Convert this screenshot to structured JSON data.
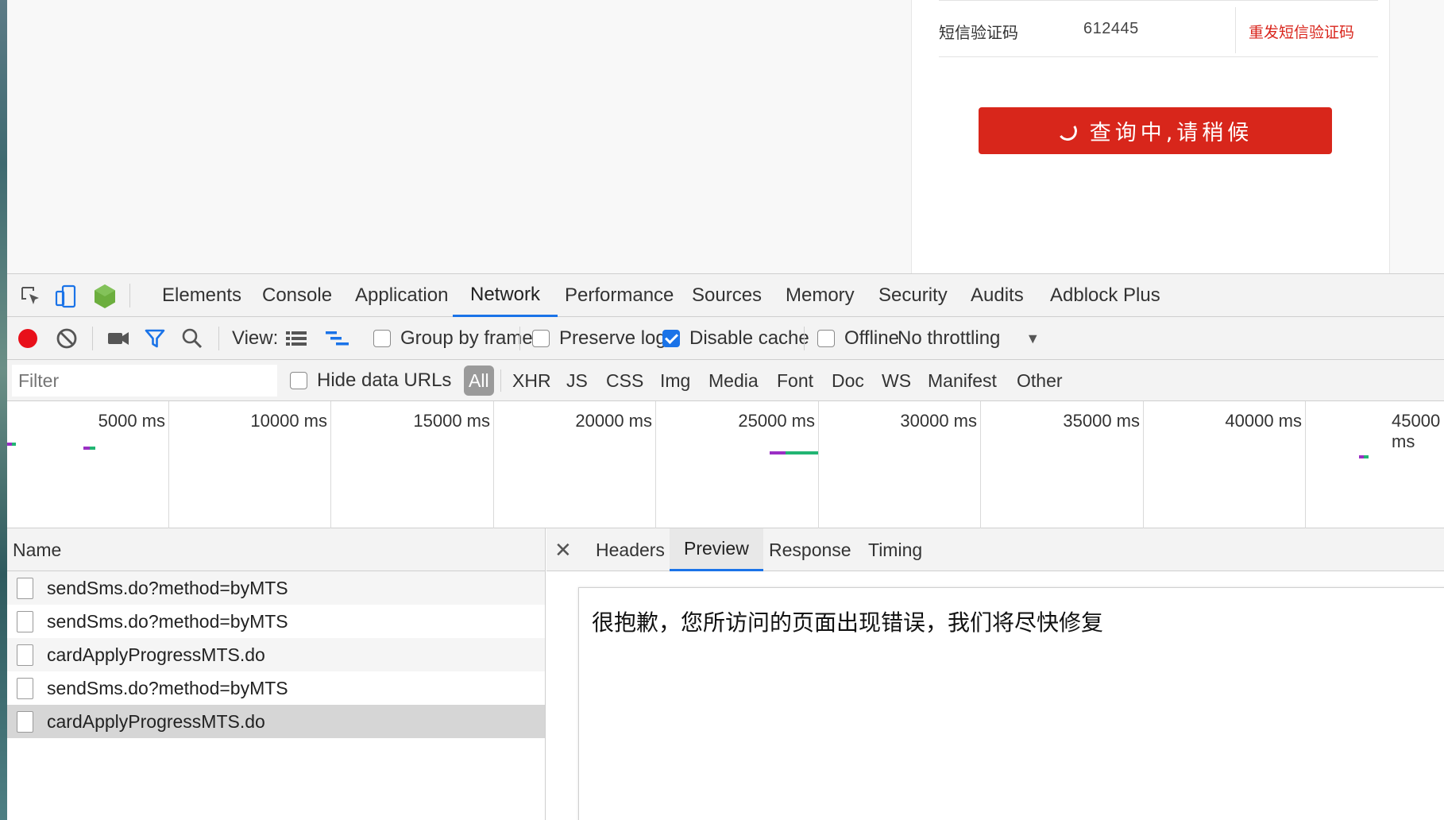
{
  "page": {
    "sms_label": "短信验证码",
    "sms_value": "612445",
    "resend_link": "重发短信验证码",
    "query_button": "查询中,请稍候"
  },
  "devtools": {
    "tabs": [
      "Elements",
      "Console",
      "Application",
      "Network",
      "Performance",
      "Sources",
      "Memory",
      "Security",
      "Audits",
      "Adblock Plus"
    ],
    "active_tab": "Network",
    "toolbar": {
      "view_label": "View:",
      "group_by_frame": "Group by frame",
      "preserve_log": "Preserve log",
      "disable_cache": "Disable cache",
      "offline": "Offline",
      "throttling": "No throttling"
    },
    "filter": {
      "placeholder": "Filter",
      "hide_data_urls": "Hide data URLs",
      "types": [
        "All",
        "XHR",
        "JS",
        "CSS",
        "Img",
        "Media",
        "Font",
        "Doc",
        "WS",
        "Manifest",
        "Other"
      ]
    },
    "overview_ticks": [
      "5000 ms",
      "10000 ms",
      "15000 ms",
      "20000 ms",
      "25000 ms",
      "30000 ms",
      "35000 ms",
      "40000 ms",
      "45000 ms"
    ],
    "name_header": "Name",
    "requests": [
      {
        "name": "sendSms.do?method=byMTS"
      },
      {
        "name": "sendSms.do?method=byMTS"
      },
      {
        "name": "cardApplyProgressMTS.do"
      },
      {
        "name": "sendSms.do?method=byMTS"
      },
      {
        "name": "cardApplyProgressMTS.do"
      }
    ],
    "selected_request_index": 4,
    "detail_tabs": [
      "Headers",
      "Preview",
      "Response",
      "Timing"
    ],
    "active_detail_tab": "Preview",
    "preview_text": "很抱歉，您所访问的页面出现错误，我们将尽快修复"
  },
  "colors": {
    "brand_red": "#d8261b",
    "link_red": "#d9251c",
    "record_red": "#e8101a",
    "accent_blue": "#1a73e8",
    "node_green": "#6cae3e"
  }
}
